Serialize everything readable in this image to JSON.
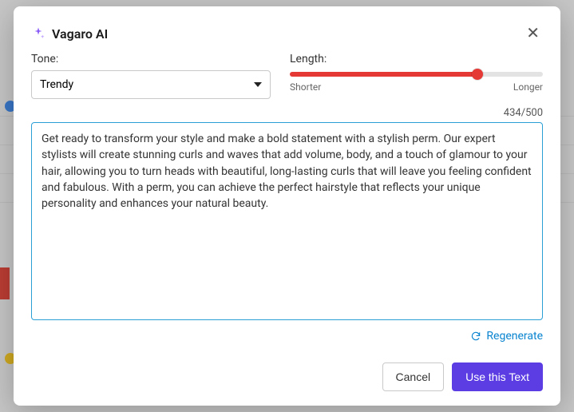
{
  "modal": {
    "title": "Vagaro AI",
    "close_glyph": "✕"
  },
  "tone": {
    "label": "Tone:",
    "selected": "Trendy"
  },
  "length": {
    "label": "Length:",
    "shorter_label": "Shorter",
    "longer_label": "Longer",
    "value_percent": 74
  },
  "counter": {
    "current": 434,
    "max": 500,
    "display": "434/500"
  },
  "body_text": "Get ready to transform your style and make a bold statement with a stylish perm. Our expert stylists will create stunning curls and waves that add volume, body, and a touch of glamour to your hair, allowing you to turn heads with beautiful, long-lasting curls that will leave you feeling confident and fabulous. With a perm, you can achieve the perfect hairstyle that reflects your unique personality and enhances your natural beauty.",
  "regenerate_label": "Regenerate",
  "buttons": {
    "cancel": "Cancel",
    "use": "Use this Text"
  },
  "colors": {
    "accent_slider": "#e53935",
    "focus_border": "#2a9fd6",
    "link_blue": "#0a84d0",
    "primary_button": "#5b3de3",
    "sparkle_purple": "#8a5cf7"
  }
}
